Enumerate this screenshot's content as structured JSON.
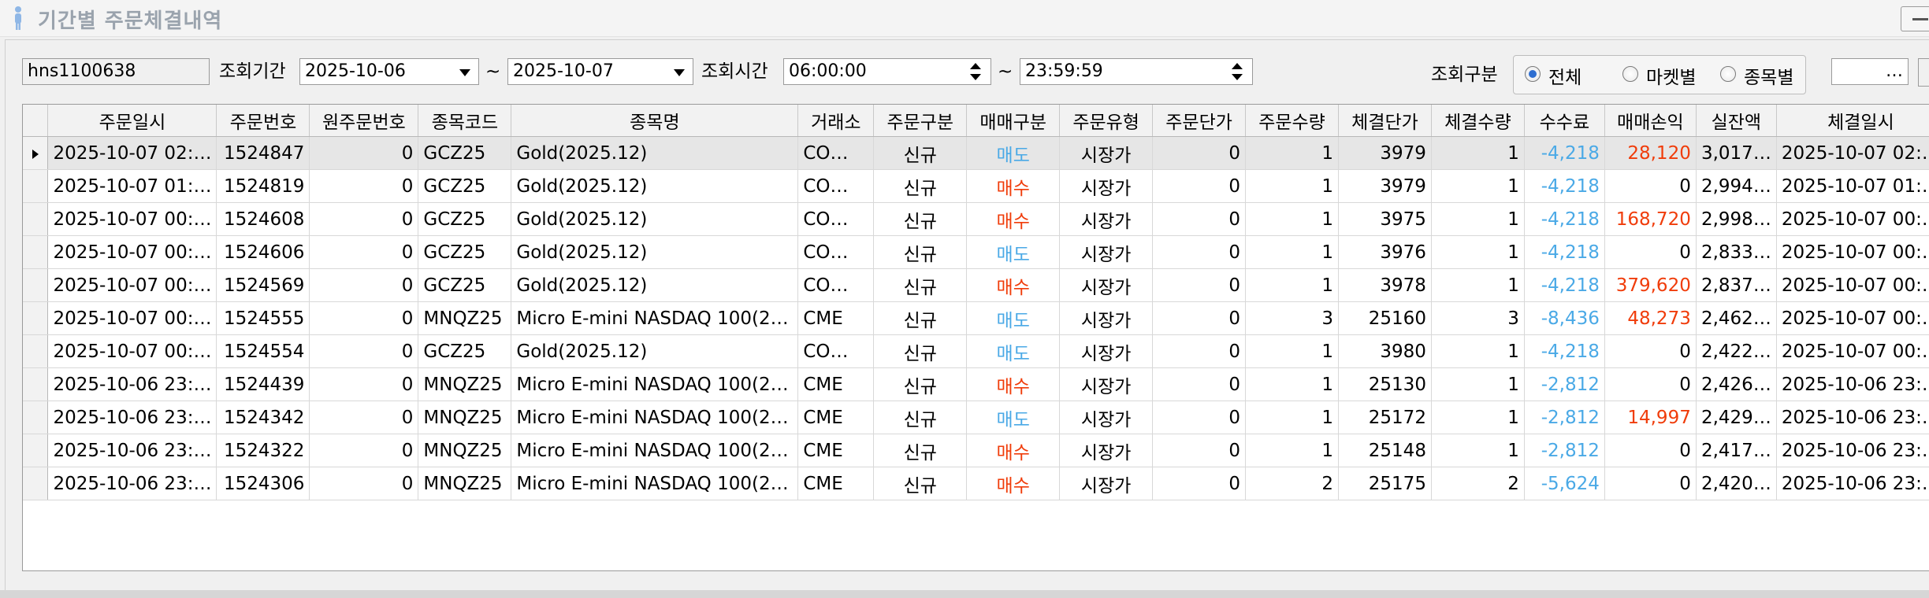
{
  "window": {
    "title": "기간별 주문체결내역"
  },
  "toolbar": {
    "account": "hns1100638",
    "period_label": "조회기간",
    "date_from": "2025-10-06",
    "tilde": "~",
    "date_to": "2025-10-07",
    "time_label": "조회시간",
    "time_from": "06:00:00",
    "time_to": "23:59:59",
    "type_label": "조회구분",
    "radio_all": "전체",
    "radio_market": "마켓별",
    "radio_item": "종목별",
    "extra_value": "…"
  },
  "grid": {
    "columns": [
      "주문일시",
      "주문번호",
      "원주문번호",
      "종목코드",
      "종목명",
      "거래소",
      "주문구분",
      "매매구분",
      "주문유형",
      "주문단가",
      "주문수량",
      "체결단가",
      "체결수량",
      "수수료",
      "매매손익",
      "실잔액",
      "체결일시"
    ],
    "rows": [
      {
        "order_time": "2025-10-07 02:…",
        "order_no": "1524847",
        "orig_no": "0",
        "code": "GCZ25",
        "name": "Gold(2025.12)",
        "exch": "CO…",
        "order_type": "신규",
        "side": "매도",
        "kind": "시장가",
        "price": "0",
        "qty": "1",
        "fill_price": "3979",
        "fill_qty": "1",
        "fee": "-4,218",
        "pnl": "28,120",
        "balance": "3,017…",
        "fill_time": "2025-10-07 02:…"
      },
      {
        "order_time": "2025-10-07 01:…",
        "order_no": "1524819",
        "orig_no": "0",
        "code": "GCZ25",
        "name": "Gold(2025.12)",
        "exch": "CO…",
        "order_type": "신규",
        "side": "매수",
        "kind": "시장가",
        "price": "0",
        "qty": "1",
        "fill_price": "3979",
        "fill_qty": "1",
        "fee": "-4,218",
        "pnl": "0",
        "balance": "2,994…",
        "fill_time": "2025-10-07 01:…"
      },
      {
        "order_time": "2025-10-07 00:…",
        "order_no": "1524608",
        "orig_no": "0",
        "code": "GCZ25",
        "name": "Gold(2025.12)",
        "exch": "CO…",
        "order_type": "신규",
        "side": "매수",
        "kind": "시장가",
        "price": "0",
        "qty": "1",
        "fill_price": "3975",
        "fill_qty": "1",
        "fee": "-4,218",
        "pnl": "168,720",
        "balance": "2,998…",
        "fill_time": "2025-10-07 00:…"
      },
      {
        "order_time": "2025-10-07 00:…",
        "order_no": "1524606",
        "orig_no": "0",
        "code": "GCZ25",
        "name": "Gold(2025.12)",
        "exch": "CO…",
        "order_type": "신규",
        "side": "매도",
        "kind": "시장가",
        "price": "0",
        "qty": "1",
        "fill_price": "3976",
        "fill_qty": "1",
        "fee": "-4,218",
        "pnl": "0",
        "balance": "2,833…",
        "fill_time": "2025-10-07 00:…"
      },
      {
        "order_time": "2025-10-07 00:…",
        "order_no": "1524569",
        "orig_no": "0",
        "code": "GCZ25",
        "name": "Gold(2025.12)",
        "exch": "CO…",
        "order_type": "신규",
        "side": "매수",
        "kind": "시장가",
        "price": "0",
        "qty": "1",
        "fill_price": "3978",
        "fill_qty": "1",
        "fee": "-4,218",
        "pnl": "379,620",
        "balance": "2,837…",
        "fill_time": "2025-10-07 00:…"
      },
      {
        "order_time": "2025-10-07 00:…",
        "order_no": "1524555",
        "orig_no": "0",
        "code": "MNQZ25",
        "name": "Micro E-mini NASDAQ 100(2…",
        "exch": "CME",
        "order_type": "신규",
        "side": "매도",
        "kind": "시장가",
        "price": "0",
        "qty": "3",
        "fill_price": "25160",
        "fill_qty": "3",
        "fee": "-8,436",
        "pnl": "48,273",
        "balance": "2,462…",
        "fill_time": "2025-10-07 00:…"
      },
      {
        "order_time": "2025-10-07 00:…",
        "order_no": "1524554",
        "orig_no": "0",
        "code": "GCZ25",
        "name": "Gold(2025.12)",
        "exch": "CO…",
        "order_type": "신규",
        "side": "매도",
        "kind": "시장가",
        "price": "0",
        "qty": "1",
        "fill_price": "3980",
        "fill_qty": "1",
        "fee": "-4,218",
        "pnl": "0",
        "balance": "2,422…",
        "fill_time": "2025-10-07 00:…"
      },
      {
        "order_time": "2025-10-06 23:…",
        "order_no": "1524439",
        "orig_no": "0",
        "code": "MNQZ25",
        "name": "Micro E-mini NASDAQ 100(2…",
        "exch": "CME",
        "order_type": "신규",
        "side": "매수",
        "kind": "시장가",
        "price": "0",
        "qty": "1",
        "fill_price": "25130",
        "fill_qty": "1",
        "fee": "-2,812",
        "pnl": "0",
        "balance": "2,426…",
        "fill_time": "2025-10-06 23:…"
      },
      {
        "order_time": "2025-10-06 23:…",
        "order_no": "1524342",
        "orig_no": "0",
        "code": "MNQZ25",
        "name": "Micro E-mini NASDAQ 100(2…",
        "exch": "CME",
        "order_type": "신규",
        "side": "매도",
        "kind": "시장가",
        "price": "0",
        "qty": "1",
        "fill_price": "25172",
        "fill_qty": "1",
        "fee": "-2,812",
        "pnl": "14,997",
        "balance": "2,429…",
        "fill_time": "2025-10-06 23:…"
      },
      {
        "order_time": "2025-10-06 23:…",
        "order_no": "1524322",
        "orig_no": "0",
        "code": "MNQZ25",
        "name": "Micro E-mini NASDAQ 100(2…",
        "exch": "CME",
        "order_type": "신규",
        "side": "매수",
        "kind": "시장가",
        "price": "0",
        "qty": "1",
        "fill_price": "25148",
        "fill_qty": "1",
        "fee": "-2,812",
        "pnl": "0",
        "balance": "2,417…",
        "fill_time": "2025-10-06 23:…"
      },
      {
        "order_time": "2025-10-06 23:…",
        "order_no": "1524306",
        "orig_no": "0",
        "code": "MNQZ25",
        "name": "Micro E-mini NASDAQ 100(2…",
        "exch": "CME",
        "order_type": "신규",
        "side": "매수",
        "kind": "시장가",
        "price": "0",
        "qty": "2",
        "fill_price": "25175",
        "fill_qty": "2",
        "fee": "-5,624",
        "pnl": "0",
        "balance": "2,420…",
        "fill_time": "2025-10-06 23:…"
      }
    ]
  },
  "colors": {
    "sell": "#4aa9e6",
    "buy": "#f03c0a",
    "fee": "#4aa9e6",
    "profit": "#f03c0a"
  }
}
